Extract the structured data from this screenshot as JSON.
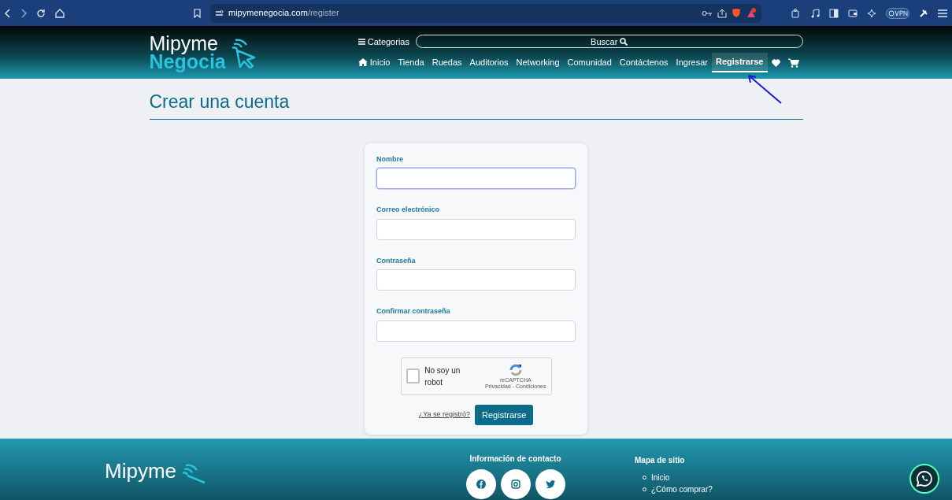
{
  "browser": {
    "url_host": "mipymenegocia.com",
    "url_path": "/register"
  },
  "header": {
    "logo_top": "Mipyme",
    "logo_bottom": "Negocia",
    "categories": "Categorias",
    "search_button": "Buscar",
    "nav": [
      {
        "label": "Inicio",
        "kind": "home",
        "selected": false
      },
      {
        "label": "Tienda",
        "kind": "text",
        "selected": false
      },
      {
        "label": "Ruedas",
        "kind": "text",
        "selected": false
      },
      {
        "label": "Auditorios",
        "kind": "text",
        "selected": false
      },
      {
        "label": "Networking",
        "kind": "text",
        "selected": false
      },
      {
        "label": "Comunidad",
        "kind": "text",
        "selected": false
      },
      {
        "label": "Contáctenos",
        "kind": "text",
        "selected": false
      },
      {
        "label": "Ingresar",
        "kind": "text",
        "selected": false
      },
      {
        "label": "Registrarse",
        "kind": "text",
        "selected": true
      }
    ]
  },
  "page_title": "Crear una cuenta",
  "form": {
    "fields": [
      {
        "label": "Nombre",
        "focused": true
      },
      {
        "label": "Correo electrónico",
        "focused": false
      },
      {
        "label": "Contraseña",
        "focused": false
      },
      {
        "label": "Confirmar contraseña",
        "focused": false
      }
    ],
    "captcha": {
      "label": "No soy un robot",
      "checked": false,
      "brand": "reCAPTCHA",
      "terms": "Privacidad - Condiciones"
    },
    "login_link": "¿Ya se registró?",
    "submit": "Registrarse"
  },
  "footer": {
    "logo": "Mipyme",
    "contact_title": "Información de contacto",
    "sitemap_title": "Mapa de sitio",
    "sitemap": [
      "Inicio",
      "¿Cómo comprar?"
    ]
  }
}
